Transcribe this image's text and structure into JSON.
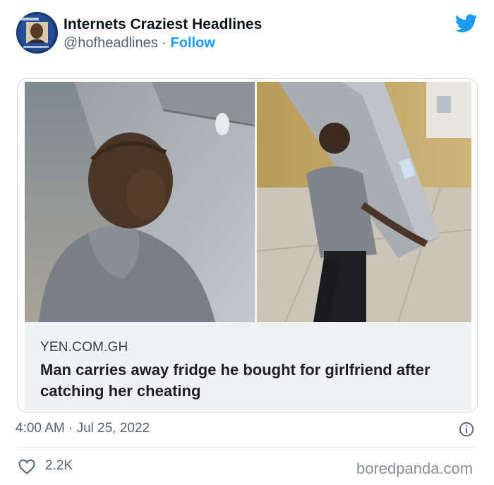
{
  "header": {
    "display_name": "Internets Craziest Headlines",
    "handle": "@hofheadlines",
    "separator": "·",
    "follow_label": "Follow"
  },
  "card": {
    "source": "YEN.COM.GH",
    "headline": "Man carries away fridge he bought for girlfriend after catching her cheating"
  },
  "footer": {
    "timestamp": "4:00 AM · Jul 25, 2022",
    "like_count": "2.2K",
    "watermark": "boredpanda.com"
  },
  "colors": {
    "twitter_blue": "#1d9bf0",
    "text_primary": "#0f1419",
    "text_secondary": "#536471"
  },
  "icons": [
    "twitter-logo-icon",
    "info-icon",
    "heart-icon"
  ]
}
